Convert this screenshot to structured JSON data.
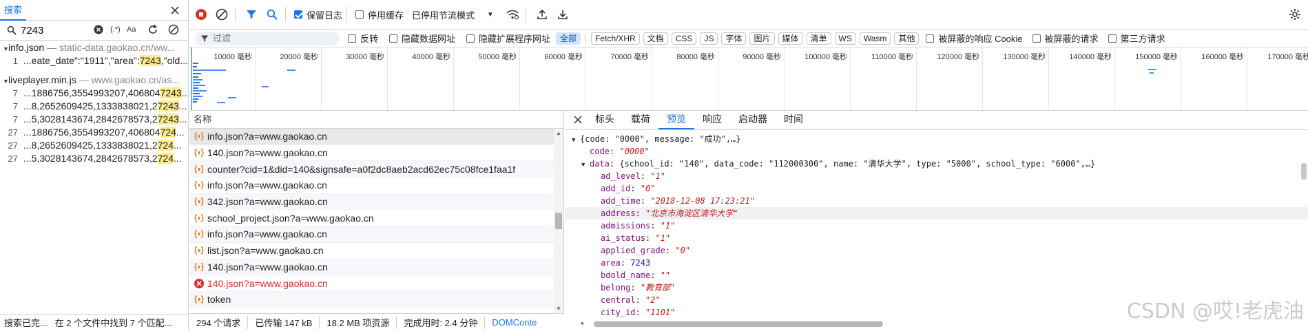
{
  "search_panel": {
    "tab_label": "搜索",
    "query": "7243",
    "opt_regex": "(.*)",
    "opt_case": "Aa",
    "results": [
      {
        "file": "info.json",
        "path": "— static-data.gaokao.cn/ww...",
        "matches": [
          {
            "line": "1",
            "pre": "...eate_date\":\"1911\",\"area\":",
            "hit": "7243",
            "post": ",\"old..."
          }
        ]
      },
      {
        "file": "liveplayer.min.js",
        "path": "— www.gaokao.cn/as...",
        "matches": [
          {
            "line": "7",
            "pre": "...1886756,3554993207,406804",
            "hit": "7243",
            "post": "..."
          },
          {
            "line": "7",
            "pre": "...8,2652609425,1333838021,2",
            "hit": "7243",
            "post": "..."
          },
          {
            "line": "7",
            "pre": "...5,3028143674,2842678573,2",
            "hit": "7243",
            "post": "..."
          },
          {
            "line": "27",
            "pre": "...1886756,3554993207,406804",
            "hit": "724",
            "post": "..."
          },
          {
            "line": "27",
            "pre": "...8,2652609425,1333838021,2",
            "hit": "724",
            "post": "..."
          },
          {
            "line": "27",
            "pre": "...5,3028143674,2842678573,2",
            "hit": "724",
            "post": "..."
          }
        ]
      }
    ],
    "status_left": "搜索已完...",
    "status_right": "在 2 个文件中找到 7 个匹配..."
  },
  "toolbar": {
    "preserve_log": "保留日志",
    "disable_cache": "停用缓存",
    "throttle": "已停用节流模式",
    "filter_placeholder": "过滤",
    "invert": "反转",
    "hide_data_urls": "隐藏数据网址",
    "hide_ext_urls": "隐藏扩展程序网址",
    "chips": [
      "全部",
      "Fetch/XHR",
      "文档",
      "CSS",
      "JS",
      "字体",
      "图片",
      "媒体",
      "清单",
      "WS",
      "Wasm",
      "其他"
    ],
    "blocked_response_cookies": "被屏蔽的响应 Cookie",
    "blocked_requests": "被屏蔽的请求",
    "third_party": "第三方请求"
  },
  "overview": {
    "ticks": [
      "10000 毫秒",
      "20000 毫秒",
      "30000 毫秒",
      "40000 毫秒",
      "50000 毫秒",
      "60000 毫秒",
      "70000 毫秒",
      "80000 毫秒",
      "90000 毫秒",
      "100000 毫秒",
      "110000 毫秒",
      "120000 毫秒",
      "130000 毫秒",
      "140000 毫秒",
      "150000 毫秒",
      "160000 毫秒",
      "170000 毫秒"
    ]
  },
  "requests": {
    "header": "名称",
    "rows": [
      {
        "name": "info.json?a=www.gaokao.cn",
        "type": "xhr",
        "state": "sel"
      },
      {
        "name": "140.json?a=www.gaokao.cn",
        "type": "xhr",
        "state": ""
      },
      {
        "name": "counter?cid=1&did=140&signsafe=a0f2dc8aeb2acd62ec75c08fce1faa1f",
        "type": "xhr",
        "state": "alt"
      },
      {
        "name": "info.json?a=www.gaokao.cn",
        "type": "xhr",
        "state": ""
      },
      {
        "name": "342.json?a=www.gaokao.cn",
        "type": "xhr",
        "state": "alt"
      },
      {
        "name": "school_project.json?a=www.gaokao.cn",
        "type": "xhr",
        "state": ""
      },
      {
        "name": "info.json?a=www.gaokao.cn",
        "type": "xhr",
        "state": "alt"
      },
      {
        "name": "list.json?a=www.gaokao.cn",
        "type": "xhr",
        "state": ""
      },
      {
        "name": "140.json?a=www.gaokao.cn",
        "type": "xhr",
        "state": "alt"
      },
      {
        "name": "140.json?a=www.gaokao.cn",
        "type": "error",
        "state": "err"
      },
      {
        "name": "token",
        "type": "xhr",
        "state": "alt"
      }
    ]
  },
  "statusbar": {
    "requests": "294 个请求",
    "transferred": "已传输 147 kB",
    "resources": "18.2 MB 项资源",
    "finish": "完成用时: 2.4 分钟",
    "dom": "DOMConte"
  },
  "detail": {
    "tabs": [
      "标头",
      "载荷",
      "预览",
      "响应",
      "启动器",
      "时间"
    ],
    "active_tab": "预览",
    "root_line": "{code: \"0000\", message: \"成功\",…}",
    "code_key": "code",
    "code_val": "\"0000\"",
    "data_key": "data",
    "data_summary": "{school_id: \"140\", data_code: \"112000300\", name: \"清华大学\", type: \"5000\", school_type: \"6000\",…}",
    "fields": [
      {
        "k": "ad_level",
        "v": "\"1\"",
        "kind": "str"
      },
      {
        "k": "add_id",
        "v": "\"0\"",
        "kind": "str"
      },
      {
        "k": "add_time",
        "v": "\"2018-12-08 17:23:21\"",
        "kind": "str"
      },
      {
        "k": "address",
        "v": "\"北京市海淀区清华大学\"",
        "kind": "str"
      },
      {
        "k": "admissions",
        "v": "\"1\"",
        "kind": "str"
      },
      {
        "k": "ai_status",
        "v": "\"1\"",
        "kind": "str"
      },
      {
        "k": "applied_grade",
        "v": "\"0\"",
        "kind": "str"
      },
      {
        "k": "area",
        "v": "7243",
        "kind": "num"
      },
      {
        "k": "bdold_name",
        "v": "\"\"",
        "kind": "str"
      },
      {
        "k": "belong",
        "v": "\"教育部\"",
        "kind": "str"
      },
      {
        "k": "central",
        "v": "\"2\"",
        "kind": "str"
      },
      {
        "k": "city_id",
        "v": "\"1101\"",
        "kind": "str"
      }
    ]
  },
  "watermark": "CSDN @哎!老虎油",
  "colors": {
    "accent": "#1a73e8",
    "highlight": "#fbeb8c",
    "error": "#d93025",
    "record_red": "#d93025"
  }
}
